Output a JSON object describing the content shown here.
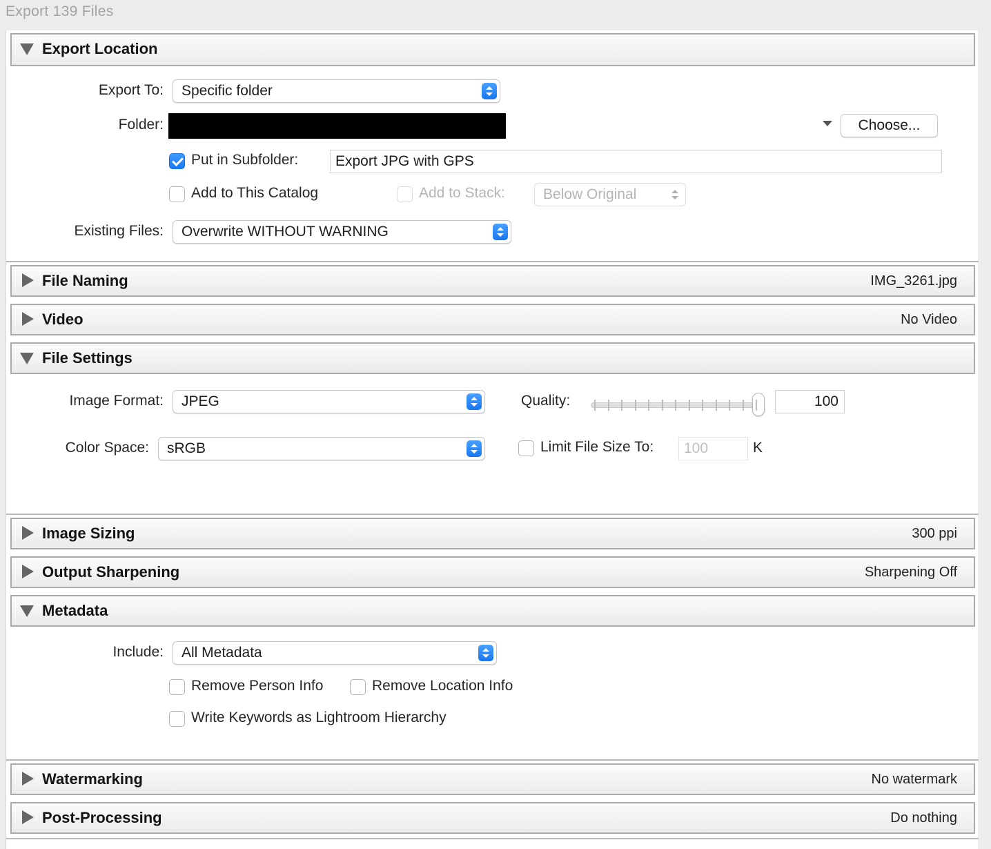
{
  "window": {
    "title": "Export 139 Files"
  },
  "sections": {
    "export_location": {
      "title": "Export Location",
      "export_to_label": "Export To:",
      "export_to_value": "Specific folder",
      "folder_label": "Folder:",
      "choose_button": "Choose...",
      "put_in_subfolder_label": "Put in Subfolder:",
      "put_in_subfolder_checked": true,
      "subfolder_name": "Export JPG with GPS",
      "add_to_catalog_label": "Add to This Catalog",
      "add_to_catalog_checked": false,
      "add_to_stack_label": "Add to Stack:",
      "add_to_stack_checked": false,
      "add_to_stack_value": "Below Original",
      "existing_files_label": "Existing Files:",
      "existing_files_value": "Overwrite WITHOUT WARNING"
    },
    "file_naming": {
      "title": "File Naming",
      "summary": "IMG_3261.jpg"
    },
    "video": {
      "title": "Video",
      "summary": "No Video"
    },
    "file_settings": {
      "title": "File Settings",
      "image_format_label": "Image Format:",
      "image_format_value": "JPEG",
      "quality_label": "Quality:",
      "quality_value": "100",
      "color_space_label": "Color Space:",
      "color_space_value": "sRGB",
      "limit_size_label": "Limit File Size To:",
      "limit_size_checked": false,
      "limit_size_value": "100",
      "limit_size_unit": "K"
    },
    "image_sizing": {
      "title": "Image Sizing",
      "summary": "300 ppi"
    },
    "output_sharpening": {
      "title": "Output Sharpening",
      "summary": "Sharpening Off"
    },
    "metadata": {
      "title": "Metadata",
      "include_label": "Include:",
      "include_value": "All Metadata",
      "remove_person_label": "Remove Person Info",
      "remove_location_label": "Remove Location Info",
      "write_keywords_label": "Write Keywords as Lightroom Hierarchy"
    },
    "watermarking": {
      "title": "Watermarking",
      "summary": "No watermark"
    },
    "post_processing": {
      "title": "Post-Processing",
      "summary": "Do nothing"
    }
  },
  "icons": {
    "expanded": "triangle-down-icon",
    "collapsed": "triangle-right-icon",
    "popup": "up-down-chevron-icon",
    "checkmark": "checkmark-icon"
  },
  "colors": {
    "accent": "#1a7af5",
    "header_border": "#aaaaaa"
  }
}
